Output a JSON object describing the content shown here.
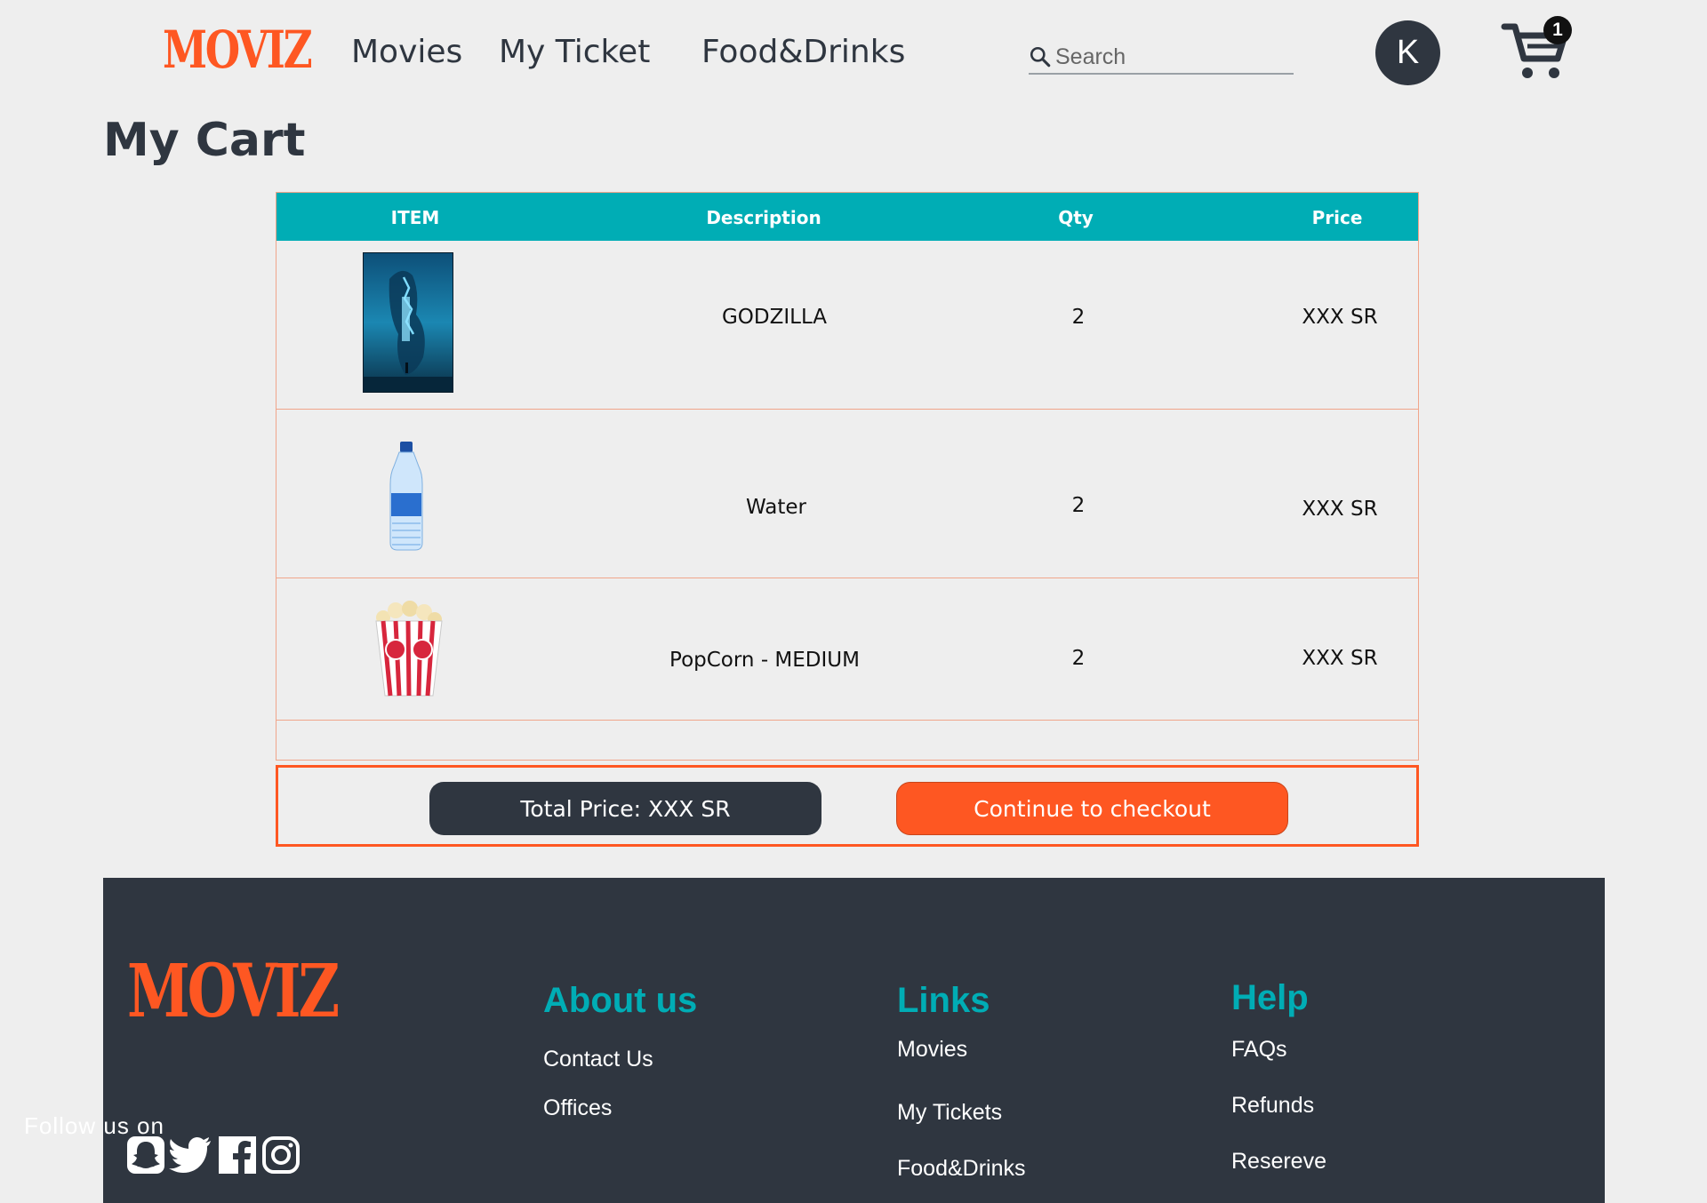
{
  "header": {
    "logo": "MOVIZ",
    "nav": [
      "Movies",
      "My Ticket",
      "Food&Drinks"
    ],
    "search_placeholder": "Search",
    "avatar_initial": "K",
    "cart_count": "1"
  },
  "page_title": "My Cart",
  "table": {
    "columns": [
      "ITEM",
      "Description",
      "Qty",
      "Price"
    ],
    "rows": [
      {
        "image": "godzilla-poster",
        "description": "GODZILLA",
        "qty": "2",
        "price": "XXX SR"
      },
      {
        "image": "water-bottle",
        "description": "Water",
        "qty": "2",
        "price": "XXX SR"
      },
      {
        "image": "popcorn-box",
        "description": "PopCorn - MEDIUM",
        "qty": "2",
        "price": "XXX SR"
      }
    ]
  },
  "totals": {
    "total_label": "Total Price: XXX SR",
    "checkout_label": "Continue to checkout"
  },
  "footer": {
    "logo": "MOVIZ",
    "follow_text": "Follow us on",
    "social_icons": [
      "snapchat-icon",
      "twitter-icon",
      "facebook-icon",
      "instagram-icon"
    ],
    "about": {
      "heading": "About us",
      "links": [
        "Contact Us",
        "Offices"
      ]
    },
    "links": {
      "heading": "Links",
      "links": [
        "Movies",
        "My Tickets",
        "Food&Drinks"
      ]
    },
    "help": {
      "heading": "Help",
      "links": [
        "FAQs",
        "Refunds",
        "Resereve"
      ]
    }
  },
  "colors": {
    "brand": "#fe5722",
    "accent": "#00adb5",
    "dark": "#2f3640",
    "background": "#eeeeee"
  }
}
